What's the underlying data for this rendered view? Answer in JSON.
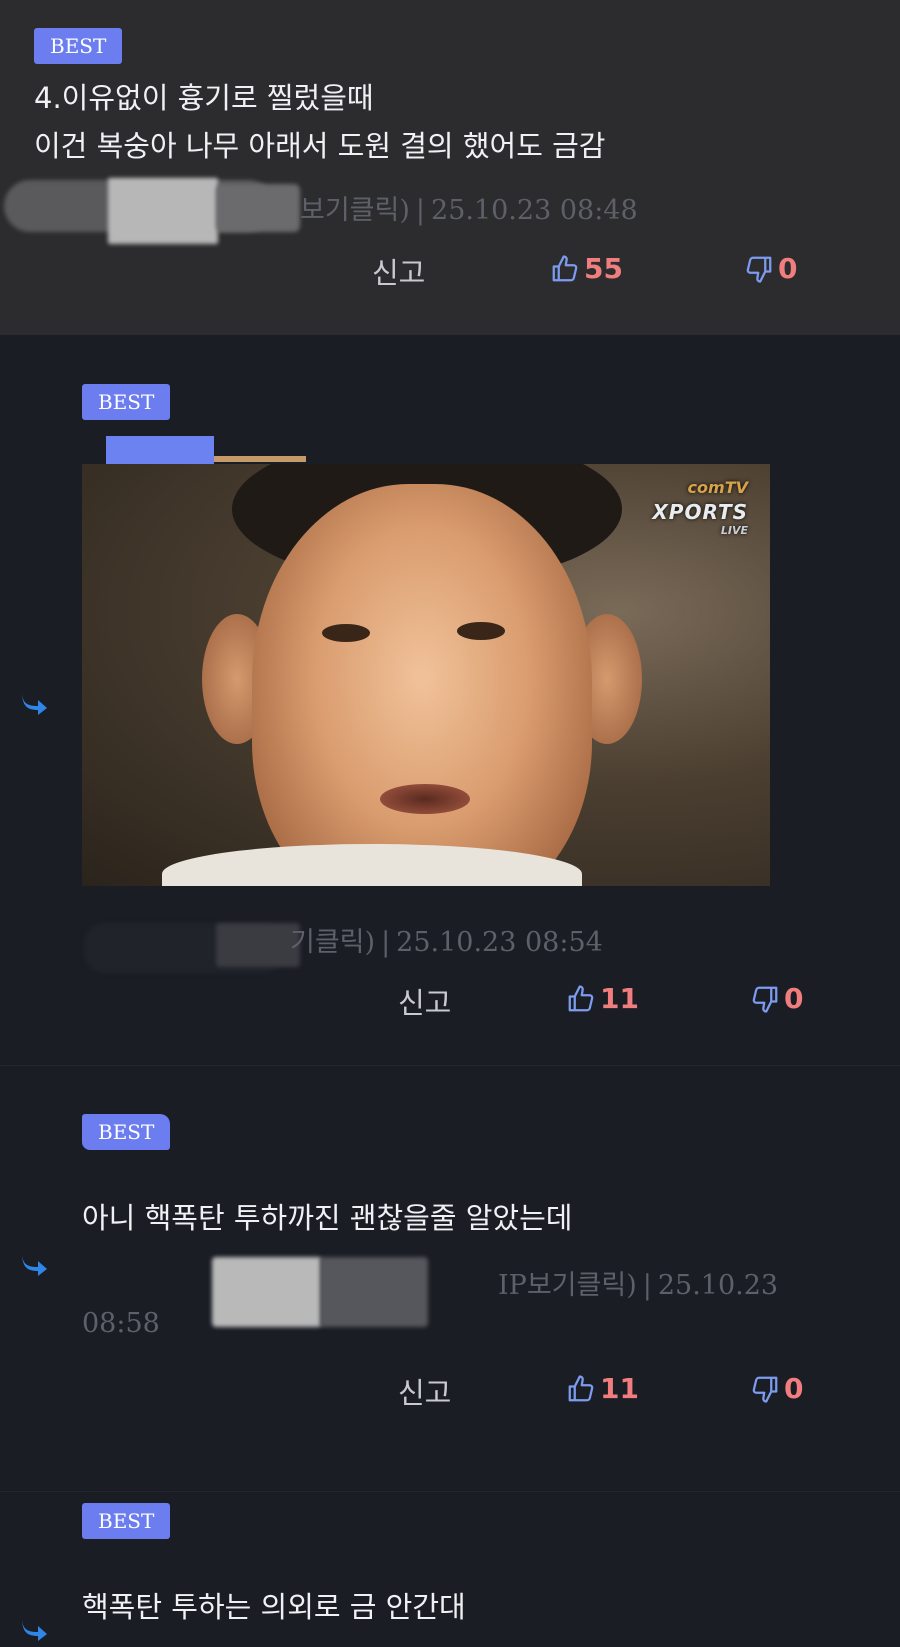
{
  "colors": {
    "best_badge": "#6c7df0",
    "like": "#7d9cf0",
    "count": "#f07e7e",
    "reply_arrow": "#2f86e6"
  },
  "comments": [
    {
      "badge": "BEST",
      "lines": [
        "4.이유없이 흉기로 찔렀을때",
        "이건 복숭아 나무 아래서 도원 결의 했어도 금감"
      ],
      "meta_author_tail": "보기클릭)",
      "meta_date": "25.10.23 08:48",
      "report": "신고",
      "likes": "55",
      "dislikes": "0"
    },
    {
      "badge": "BEST",
      "image_logo": {
        "line1": "com",
        "line1_sup": "TV",
        "line2": "XPORTS",
        "line3": "LIVE"
      },
      "meta_author_tail": "기클릭)",
      "meta_date": "25.10.23 08:54",
      "report": "신고",
      "likes": "11",
      "dislikes": "0"
    },
    {
      "badge": "BEST",
      "lines": [
        "아니 핵폭탄 투하까진 괜찮을줄 알았는데"
      ],
      "meta_author_tail": "IP보기클릭)",
      "meta_date_line1": "25.10.23",
      "meta_date_line2": "08:58",
      "report": "신고",
      "likes": "11",
      "dislikes": "0"
    },
    {
      "badge": "BEST",
      "lines": [
        "핵폭탄 투하는 의외로 금 안간대"
      ]
    }
  ]
}
